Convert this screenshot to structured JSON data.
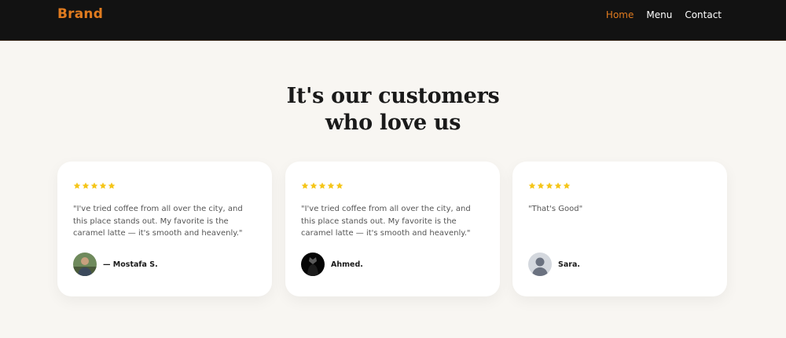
{
  "nav": {
    "brand": "Brand",
    "links": [
      {
        "label": "Home",
        "active": true
      },
      {
        "label": "Menu",
        "active": false
      },
      {
        "label": "Contact",
        "active": false
      }
    ]
  },
  "section": {
    "heading_line1": "It's our customers",
    "heading_line2": "who love us"
  },
  "testimonials": [
    {
      "rating": 5,
      "quote": "\"I've tried coffee from all over the city, and this place stands out. My favorite is the caramel latte — it's smooth and heavenly.\"",
      "author": "— Mostafa S."
    },
    {
      "rating": 5,
      "quote": "\"I've tried coffee from all over the city, and this place stands out. My favorite is the caramel latte — it's smooth and heavenly.\"",
      "author": "Ahmed."
    },
    {
      "rating": 5,
      "quote": "\"That's Good\"",
      "author": "Sara."
    }
  ],
  "colors": {
    "accent": "#e07b1f",
    "navbar_bg": "#121212",
    "page_bg": "#f8f6f2",
    "star": "#f5c518"
  }
}
